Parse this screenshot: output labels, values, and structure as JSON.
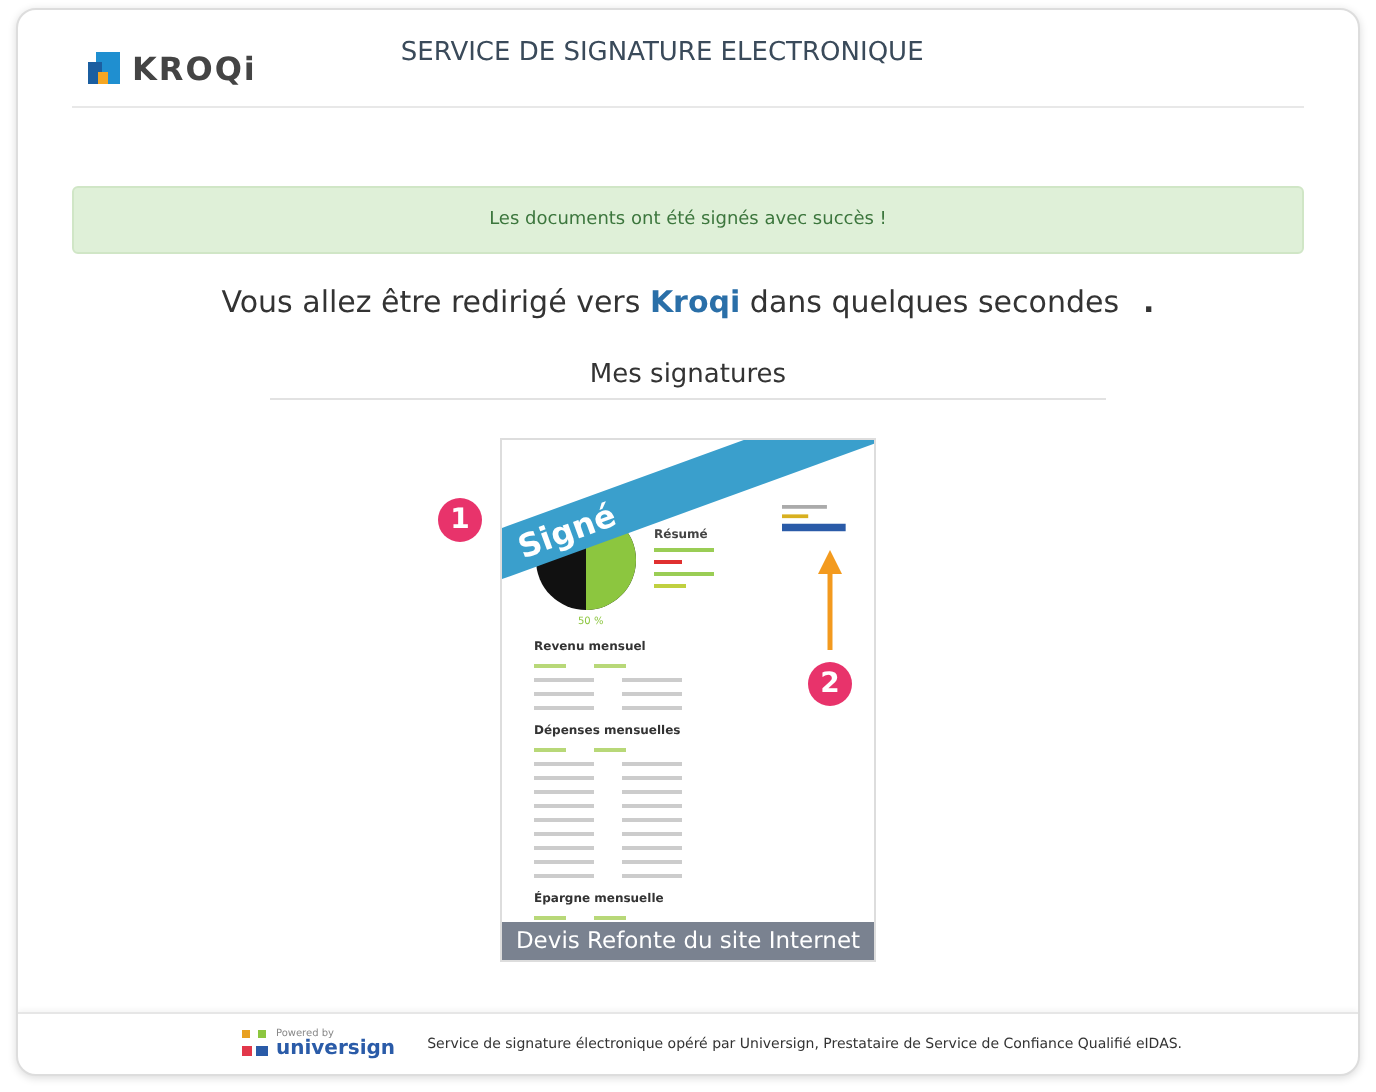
{
  "header": {
    "logo_text": "KROQi",
    "title": "SERVICE DE SIGNATURE ELECTRONIQUE"
  },
  "alert": {
    "message": "Les documents ont été signés avec succès !"
  },
  "redirect": {
    "before": "Vous allez être redirigé vers",
    "brand": "Kroqi",
    "after": "dans quelques secondes",
    "dots": "."
  },
  "section_title": "Mes signatures",
  "documents": [
    {
      "caption": "Devis Refonte du site Internet",
      "signed": true,
      "badge": "Signé",
      "preview": {
        "summary_title": "Résumé",
        "pie_label": "50 %",
        "sections": [
          "Revenu mensuel",
          "Dépenses mensuelles",
          "Épargne mensuelle"
        ]
      }
    }
  ],
  "annotations": [
    {
      "number": "1"
    },
    {
      "number": "2"
    }
  ],
  "footer": {
    "powered_by": "Powered by",
    "brand": "universign",
    "text": "Service de signature électronique opéré par Universign, Prestataire de Service de Confiance Qualifié eIDAS."
  }
}
